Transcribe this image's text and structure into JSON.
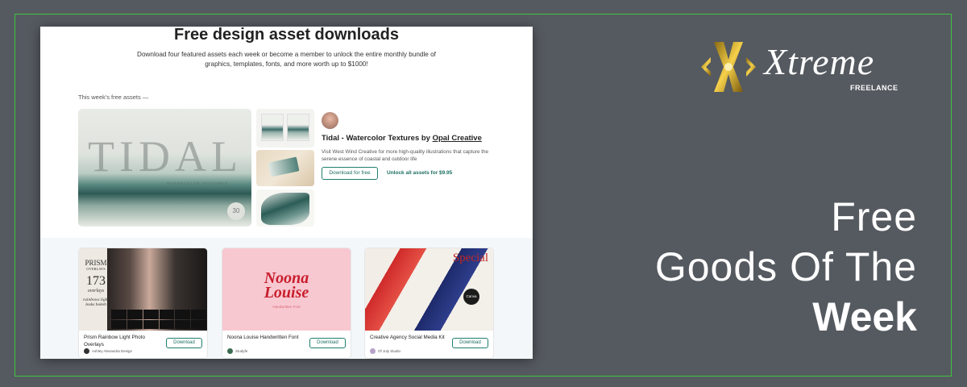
{
  "screenshot": {
    "title": "Free design asset downloads",
    "subtitle": "Download four featured assets each week or become a member to unlock the entire monthly bundle of graphics, templates, fonts, and more worth up to $1000!",
    "week_label": "This week's free assets —",
    "featured": {
      "hero_title": "TIDAL",
      "hero_subtitle": "WATERCOLOR TEXTURES",
      "hero_badge": "30",
      "title_prefix": "Tidal - Watercolor Textures by ",
      "title_author": "Opal Creative",
      "description": "Visit West Wind Creative for more high-quality illustrations that capture the serene essence of coastal and outdoor life",
      "download_label": "Download for free",
      "unlock_label": "Unlock all assets for $9.95"
    },
    "cards": [
      {
        "name": "Prism Rainbow Light Photo Overlays",
        "author": "Ashley Alexandra Design",
        "download_label": "Download",
        "image_text": {
          "line1": "PRISM",
          "line2": "OVERLAYS",
          "line3": "173",
          "line4": "overlays",
          "line5": "rainbows light leaks bokeh"
        }
      },
      {
        "name": "Noona Louise Handwritten Font",
        "author": "Studyfe",
        "download_label": "Download",
        "image_text": {
          "line1": "Noona",
          "line2": "Louise",
          "line3": "Handwritten Font"
        }
      },
      {
        "name": "Creative Agency Social Media Kit",
        "author": "Of July Studio",
        "download_label": "Download",
        "image_text": {
          "line1": "Special",
          "line2": "Canva"
        }
      }
    ]
  },
  "brand": {
    "name": "Xtreme",
    "tagline": "FREELANCE",
    "gold": "#d4a017",
    "accent_green": "#3fc43f"
  },
  "headline": {
    "line1": "Free",
    "line2": "Goods Of The",
    "line3": "Week"
  },
  "colors": {
    "background": "#555a60",
    "button_teal": "#1d7f6f"
  }
}
